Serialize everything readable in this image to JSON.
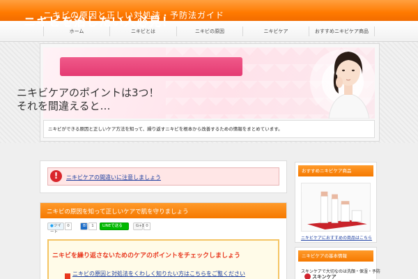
{
  "site": {
    "title": "ニキビの原因と正しい対処法・予防法ガイド"
  },
  "nav": {
    "items": [
      {
        "label": "ホーム"
      },
      {
        "label": "ニキビとは"
      },
      {
        "label": "ニキビの原因"
      },
      {
        "label": "ニキビケア"
      },
      {
        "label": "おすすめニキビケア商品"
      }
    ]
  },
  "hero": {
    "headline": "ニキビを治したい人必見！",
    "line1": "ニキビケアのポイントは3つ！",
    "line2": "それを間違えると…",
    "caption": "ニキビができる原因と正しいケア方法を知って、繰り返すニキビを根本から改善するための情報をまとめています。"
  },
  "alert": {
    "icon": "alert-icon",
    "link_text": "ニキビケアの間違いに注意しましょう"
  },
  "article": {
    "title": "ニキビの原因を知って正しいケアで肌を守りましょう",
    "share": {
      "twitter_label": "ツイート",
      "twitter_count": "0",
      "hatena_label": "B!",
      "hatena_count": "1",
      "line_label": "LINEで送る",
      "gplus_label": "G+1",
      "gplus_count": "0"
    },
    "toc": {
      "title": "ニキビを繰り返さないためのケアのポイントをチェックしましょう",
      "link": "ニキビの原因と対処法をくわしく知りたい方はこちらをご覧ください"
    }
  },
  "sidebar": {
    "box1": {
      "heading": "おすすめニキビケア商品",
      "link": "ニキビケアにおすすめの商品はこちら"
    },
    "box2": {
      "heading": "ニキビケアの基本情報",
      "text": "スキンケアで大切なのは洗顔・保湿・予防",
      "logo_label": "スキンケア"
    }
  },
  "colors": {
    "header_orange": "#ff7a00",
    "link_blue": "#1a3c9f",
    "alert_red": "#d9262c",
    "banner_pink": "#e43a72"
  }
}
